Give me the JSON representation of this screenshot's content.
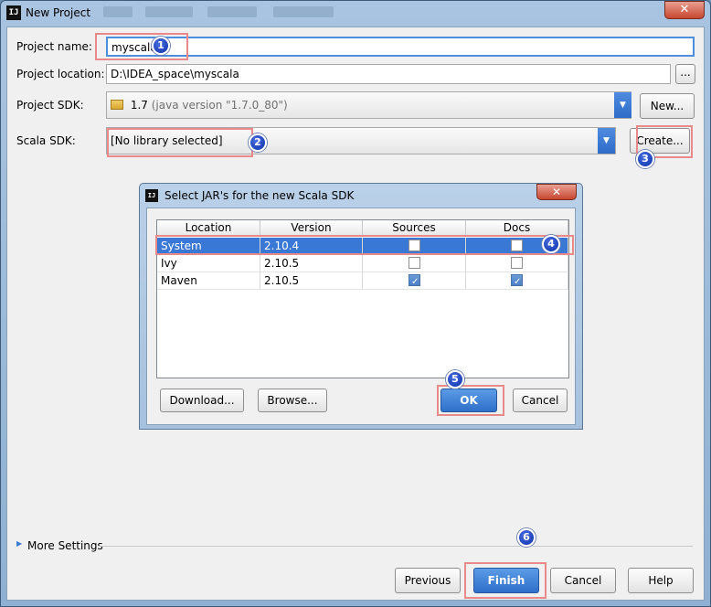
{
  "window": {
    "title": "New Project",
    "app_icon": "IJ",
    "close_glyph": "✕"
  },
  "form": {
    "project_name_label": "Project name:",
    "project_name_value": "myscala",
    "project_location_label": "Project location:",
    "project_location_value": "D:\\IDEA_space\\myscala",
    "browse_glyph": "...",
    "project_sdk_label": "Project SDK:",
    "project_sdk_value": "1.7",
    "project_sdk_detail": "(java version \"1.7.0_80\")",
    "new_button": "New...",
    "scala_sdk_label": "Scala SDK:",
    "scala_sdk_value": "[No library selected]",
    "create_button": "Create..."
  },
  "dialog": {
    "title": "Select JAR's for the new Scala SDK",
    "close_glyph": "✕",
    "columns": [
      "Location",
      "Version",
      "Sources",
      "Docs"
    ],
    "rows": [
      {
        "location": "System",
        "version": "2.10.4",
        "sources": false,
        "docs": false,
        "selected": true
      },
      {
        "location": "Ivy",
        "version": "2.10.5",
        "sources": false,
        "docs": false,
        "selected": false
      },
      {
        "location": "Maven",
        "version": "2.10.5",
        "sources": true,
        "docs": true,
        "selected": false
      }
    ],
    "download_button": "Download...",
    "browse_button": "Browse...",
    "ok_button": "OK",
    "cancel_button": "Cancel"
  },
  "footer": {
    "more_settings": "More Settings",
    "previous_button": "Previous",
    "finish_button": "Finish",
    "cancel_button": "Cancel",
    "help_button": "Help"
  },
  "annotations": [
    "1",
    "2",
    "3",
    "4",
    "5",
    "6"
  ],
  "colors": {
    "accent": "#3a78d6",
    "highlight_box": "#e88a8a",
    "badge": "#0a2fa8"
  }
}
